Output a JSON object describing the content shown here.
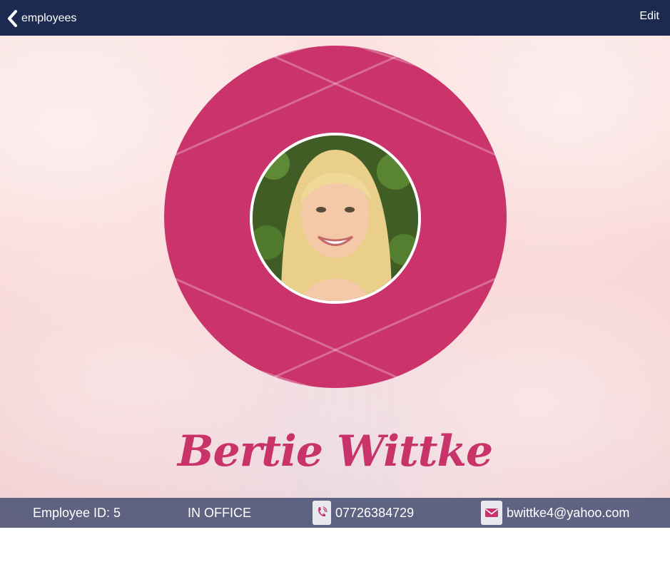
{
  "topbar": {
    "back_label": "employees",
    "edit_label": "Edit"
  },
  "profile": {
    "name": "Bertie Wittke",
    "avatar_alt": "profile photo"
  },
  "info": {
    "employee_id": "Employee ID: 5",
    "status": "IN OFFICE",
    "phone": "07726384729",
    "email": "bwittke4@yahoo.com"
  },
  "colors": {
    "topbar": "#1c2a4f",
    "accent": "#c8336a",
    "infobar": "#3e486c"
  },
  "icons": [
    "chevron-left-icon",
    "phone-icon",
    "envelope-icon"
  ]
}
